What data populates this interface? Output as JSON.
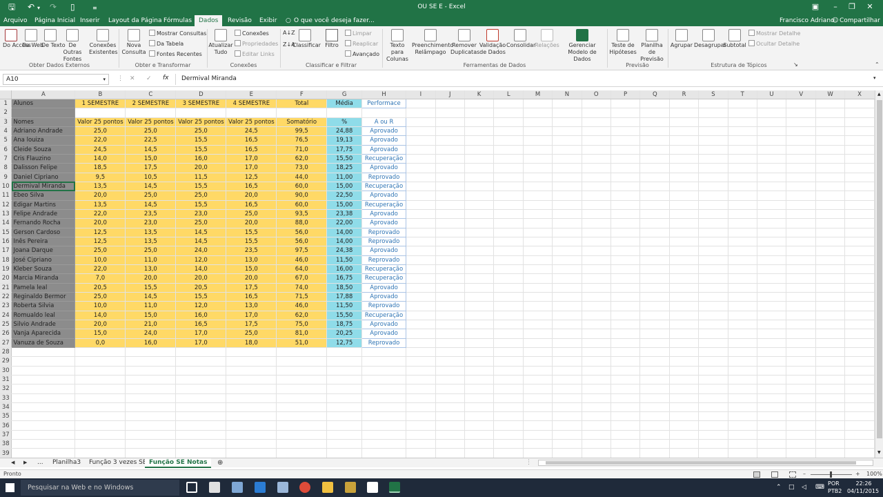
{
  "window": {
    "title": "OU SE E - Excel",
    "user": "Francisco Adriano",
    "share": "Compartilhar"
  },
  "tabs": [
    "Arquivo",
    "Página Inicial",
    "Inserir",
    "Layout da Página",
    "Fórmulas",
    "Dados",
    "Revisão",
    "Exibir"
  ],
  "tellme": "O que você deseja fazer...",
  "ribbon": {
    "get_external": {
      "label": "Obter Dados Externos",
      "buttons": [
        "Do Access",
        "Da Web",
        "De Texto",
        "De Outras Fontes",
        "Conexões Existentes"
      ]
    },
    "get_transform": {
      "label": "Obter e Transformar",
      "new_query": "Nova Consulta",
      "small": [
        "Mostrar Consultas",
        "Da Tabela",
        "Fontes Recentes"
      ]
    },
    "connections": {
      "label": "Conexões",
      "refresh": "Atualizar Tudo",
      "small": [
        "Conexões",
        "Propriedades",
        "Editar Links"
      ]
    },
    "sort_filter": {
      "label": "Classificar e Filtrar",
      "sort": "Classificar",
      "filter": "Filtro",
      "small": [
        "Limpar",
        "Reaplicar",
        "Avançado"
      ]
    },
    "data_tools": {
      "label": "Ferramentas de Dados",
      "buttons": [
        "Texto para Colunas",
        "Preenchimento Relâmpago",
        "Remover Duplicatas",
        "Validação de Dados",
        "Consolidar",
        "Relações",
        "Gerenciar Modelo de Dados"
      ]
    },
    "forecast": {
      "label": "Previsão",
      "buttons": [
        "Teste de Hipóteses",
        "Planilha de Previsão"
      ]
    },
    "outline": {
      "label": "Estrutura de Tópicos",
      "buttons": [
        "Agrupar",
        "Desagrupar",
        "Subtotal"
      ],
      "small": [
        "Mostrar Detalhe",
        "Ocultar Detalhe"
      ]
    }
  },
  "formula_bar": {
    "name_box": "A10",
    "fx": "fx",
    "value": "Dermival Miranda"
  },
  "columns": [
    "A",
    "B",
    "C",
    "D",
    "E",
    "F",
    "G",
    "H",
    "I",
    "J",
    "K",
    "L",
    "M",
    "N",
    "O",
    "P",
    "Q",
    "R",
    "S",
    "T",
    "U",
    "V",
    "W",
    "X"
  ],
  "header_row1": [
    "Alunos",
    "1 SEMESTRE",
    "2 SEMESTRE",
    "3 SEMESTRE",
    "4 SEMESTRE",
    "Total",
    "Média",
    "Performace"
  ],
  "header_row3": [
    "Nomes",
    "Valor 25 pontos",
    "Valor 25 pontos",
    "Valor 25 pontos",
    "Valor 25 pontos",
    "Somatório",
    "%",
    "A ou R"
  ],
  "students": [
    [
      "Adriano Andrade",
      "25,0",
      "25,0",
      "25,0",
      "24,5",
      "99,5",
      "24,88",
      "Aprovado"
    ],
    [
      "Ana louiza",
      "22,0",
      "22,5",
      "15,5",
      "16,5",
      "76,5",
      "19,13",
      "Aprovado"
    ],
    [
      "Cleide Souza",
      "24,5",
      "14,5",
      "15,5",
      "16,5",
      "71,0",
      "17,75",
      "Aprovado"
    ],
    [
      "Cris Flauzino",
      "14,0",
      "15,0",
      "16,0",
      "17,0",
      "62,0",
      "15,50",
      "Recuperação"
    ],
    [
      "Dalisson Felipe",
      "18,5",
      "17,5",
      "20,0",
      "17,0",
      "73,0",
      "18,25",
      "Aprovado"
    ],
    [
      "Daniel Cipriano",
      "9,5",
      "10,5",
      "11,5",
      "12,5",
      "44,0",
      "11,00",
      "Reprovado"
    ],
    [
      "Dermival Miranda",
      "13,5",
      "14,5",
      "15,5",
      "16,5",
      "60,0",
      "15,00",
      "Recuperação"
    ],
    [
      "Ebeo Silva",
      "20,0",
      "25,0",
      "25,0",
      "20,0",
      "90,0",
      "22,50",
      "Aprovado"
    ],
    [
      "Edigar Martins",
      "13,5",
      "14,5",
      "15,5",
      "16,5",
      "60,0",
      "15,00",
      "Recuperação"
    ],
    [
      "Felipe Andrade",
      "22,0",
      "23,5",
      "23,0",
      "25,0",
      "93,5",
      "23,38",
      "Aprovado"
    ],
    [
      "Fernando Rocha",
      "20,0",
      "23,0",
      "25,0",
      "20,0",
      "88,0",
      "22,00",
      "Aprovado"
    ],
    [
      "Gerson Cardoso",
      "12,5",
      "13,5",
      "14,5",
      "15,5",
      "56,0",
      "14,00",
      "Reprovado"
    ],
    [
      "Inês Pereira",
      "12,5",
      "13,5",
      "14,5",
      "15,5",
      "56,0",
      "14,00",
      "Reprovado"
    ],
    [
      "Joana Darque",
      "25,0",
      "25,0",
      "24,0",
      "23,5",
      "97,5",
      "24,38",
      "Aprovado"
    ],
    [
      "José Cipriano",
      "10,0",
      "11,0",
      "12,0",
      "13,0",
      "46,0",
      "11,50",
      "Reprovado"
    ],
    [
      "Kleber Souza",
      "22,0",
      "13,0",
      "14,0",
      "15,0",
      "64,0",
      "16,00",
      "Recuperação"
    ],
    [
      "Marcia Miranda",
      "7,0",
      "20,0",
      "20,0",
      "20,0",
      "67,0",
      "16,75",
      "Recuperação"
    ],
    [
      "Pamela leal",
      "20,5",
      "15,5",
      "20,5",
      "17,5",
      "74,0",
      "18,50",
      "Aprovado"
    ],
    [
      "Reginaldo Bermor",
      "25,0",
      "14,5",
      "15,5",
      "16,5",
      "71,5",
      "17,88",
      "Aprovado"
    ],
    [
      "Roberta Silvia",
      "10,0",
      "11,0",
      "12,0",
      "13,0",
      "46,0",
      "11,50",
      "Reprovado"
    ],
    [
      "Romualdo leal",
      "14,0",
      "15,0",
      "16,0",
      "17,0",
      "62,0",
      "15,50",
      "Recuperação"
    ],
    [
      "Silvio Andrade",
      "20,0",
      "21,0",
      "16,5",
      "17,5",
      "75,0",
      "18,75",
      "Aprovado"
    ],
    [
      "Vanja Aparecida",
      "15,0",
      "24,0",
      "17,0",
      "25,0",
      "81,0",
      "20,25",
      "Aprovado"
    ],
    [
      "Vanuza de Souza",
      "0,0",
      "16,0",
      "17,0",
      "18,0",
      "51,0",
      "12,75",
      "Reprovado"
    ]
  ],
  "sheets": {
    "more": "...",
    "tabs": [
      "Planilha3",
      "Função 3 vezes SE",
      "Função SE Notas"
    ],
    "active": "Função SE Notas"
  },
  "status": {
    "text": "Pronto",
    "zoom": "100%"
  },
  "taskbar": {
    "search": "Pesquisar na Web e no Windows",
    "lang1": "POR",
    "lang2": "PTB2",
    "time": "22:26",
    "date": "04/11/2015"
  },
  "colors": {
    "excel_green": "#217346",
    "yellow": "#ffd966",
    "cyan": "#8fdce9",
    "gray": "#8c8c8c",
    "link_blue": "#2e74b5"
  }
}
